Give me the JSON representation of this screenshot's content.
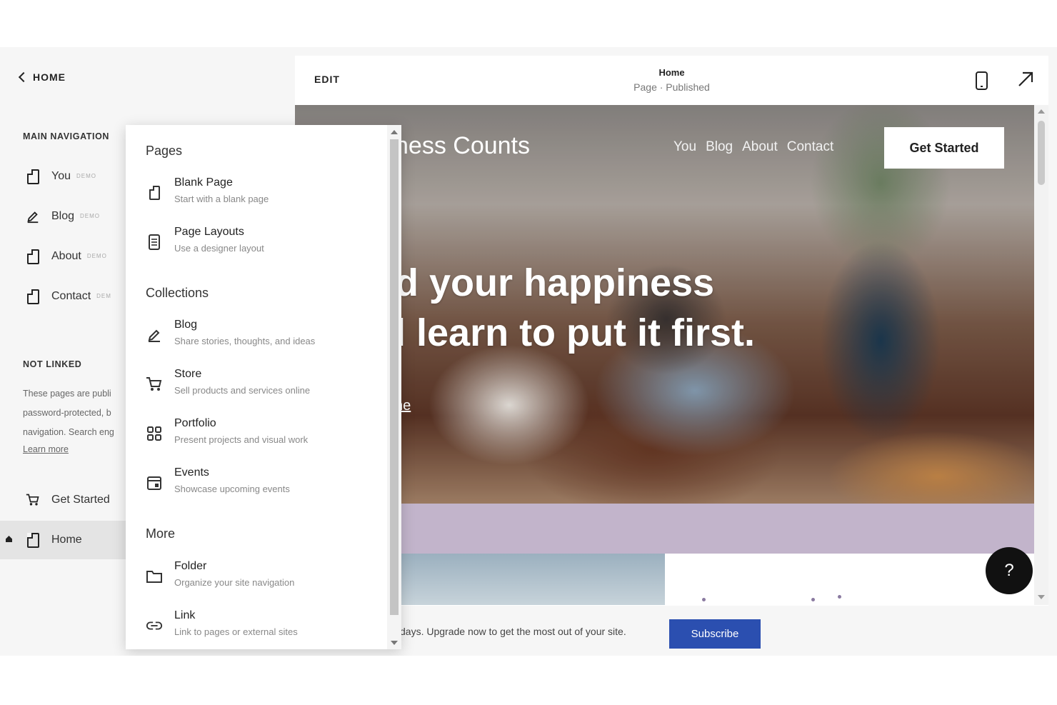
{
  "sidebar": {
    "back_label": "HOME",
    "main_nav_title": "MAIN NAVIGATION",
    "items": [
      {
        "label": "You",
        "badge": "DEMO",
        "icon": "page-icon"
      },
      {
        "label": "Blog",
        "badge": "DEMO",
        "icon": "blog-icon"
      },
      {
        "label": "About",
        "badge": "DEMO",
        "icon": "page-icon"
      },
      {
        "label": "Contact",
        "badge": "DEM",
        "icon": "page-icon"
      }
    ],
    "not_linked_title": "NOT LINKED",
    "not_linked_lines": [
      "These pages are publi",
      "password-protected, b",
      "navigation. Search eng"
    ],
    "learn_more": "Learn more",
    "extra_items": [
      {
        "label": "Get Started",
        "icon": "cart-icon"
      },
      {
        "label": "Home",
        "icon": "page-icon",
        "home_marker": "home-icon"
      }
    ]
  },
  "editor": {
    "edit_label": "EDIT",
    "page_title": "Home",
    "page_status": "Page · Published"
  },
  "preview": {
    "site_title": "ness Counts",
    "nav": [
      "You",
      "Blog",
      "About",
      "Contact"
    ],
    "cta": "Get Started",
    "headline_1": "d your happiness",
    "headline_2": "l learn to put it first.",
    "hero_link": "ne",
    "band_color": "#c2b4cb"
  },
  "trial": {
    "text": "days. Upgrade now to get the most out of your site.",
    "subscribe": "Subscribe",
    "subscribe_color": "#2b4fb0"
  },
  "help_label": "?",
  "menu": {
    "pages_title": "Pages",
    "pages": [
      {
        "title": "Blank Page",
        "desc": "Start with a blank page",
        "icon": "blank-page-icon"
      },
      {
        "title": "Page Layouts",
        "desc": "Use a designer layout",
        "icon": "layouts-icon"
      }
    ],
    "collections_title": "Collections",
    "collections": [
      {
        "title": "Blog",
        "desc": "Share stories, thoughts, and ideas",
        "icon": "blog-icon"
      },
      {
        "title": "Store",
        "desc": "Sell products and services online",
        "icon": "cart-icon"
      },
      {
        "title": "Portfolio",
        "desc": "Present projects and visual work",
        "icon": "grid-icon"
      },
      {
        "title": "Events",
        "desc": "Showcase upcoming events",
        "icon": "calendar-icon"
      }
    ],
    "more_title": "More",
    "more": [
      {
        "title": "Folder",
        "desc": "Organize your site navigation",
        "icon": "folder-icon"
      },
      {
        "title": "Link",
        "desc": "Link to pages or external sites",
        "icon": "link-icon"
      }
    ]
  }
}
